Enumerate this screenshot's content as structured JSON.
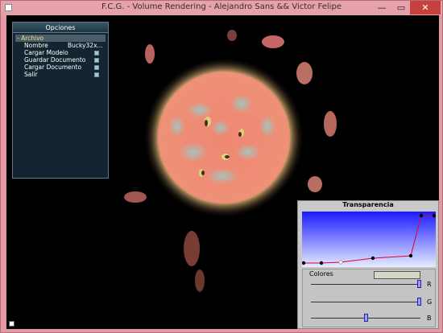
{
  "window": {
    "title": "F.C.G. - Volume Rendering - Alejandro Sans && Victor Felipe",
    "minimize": "—",
    "maximize": "▭",
    "close": "✕"
  },
  "opciones": {
    "title": "Opciones",
    "menu": "- Archivo",
    "items": [
      {
        "label": "Nombre",
        "value": "Bucky32x..."
      },
      {
        "label": "Cargar Modelo"
      },
      {
        "label": "Guardar Documento"
      },
      {
        "label": "Cargar Documento"
      },
      {
        "label": "Salir"
      }
    ]
  },
  "transparencia": {
    "title": "Transparencia",
    "colores_label": "Colores",
    "channels": [
      {
        "letter": "R",
        "value": 1.0
      },
      {
        "letter": "G",
        "value": 1.0
      },
      {
        "letter": "B",
        "value": 0.5
      }
    ]
  },
  "colors": {
    "titlebar": "#e6a2ab",
    "close": "#c7403d",
    "viewport": "#000000",
    "panel": "#142834",
    "menu_highlight": "#f4e08a"
  },
  "icons": [
    "app-icon",
    "minimize-icon",
    "maximize-icon",
    "close-icon",
    "corner-icon"
  ]
}
